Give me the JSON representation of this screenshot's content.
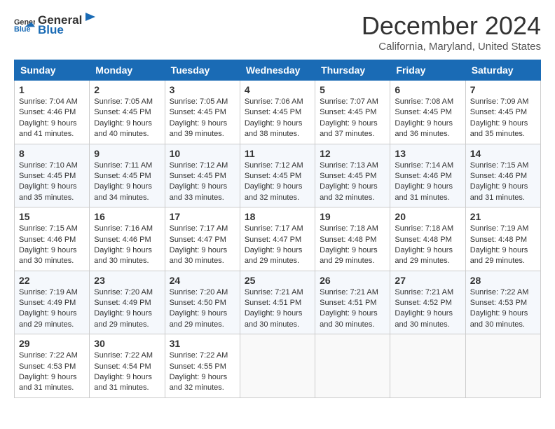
{
  "logo": {
    "general": "General",
    "blue": "Blue"
  },
  "title": "December 2024",
  "subtitle": "California, Maryland, United States",
  "days": [
    "Sunday",
    "Monday",
    "Tuesday",
    "Wednesday",
    "Thursday",
    "Friday",
    "Saturday"
  ],
  "weeks": [
    [
      {
        "day": 1,
        "lines": [
          "Sunrise: 7:04 AM",
          "Sunset: 4:46 PM",
          "Daylight: 9 hours",
          "and 41 minutes."
        ]
      },
      {
        "day": 2,
        "lines": [
          "Sunrise: 7:05 AM",
          "Sunset: 4:45 PM",
          "Daylight: 9 hours",
          "and 40 minutes."
        ]
      },
      {
        "day": 3,
        "lines": [
          "Sunrise: 7:05 AM",
          "Sunset: 4:45 PM",
          "Daylight: 9 hours",
          "and 39 minutes."
        ]
      },
      {
        "day": 4,
        "lines": [
          "Sunrise: 7:06 AM",
          "Sunset: 4:45 PM",
          "Daylight: 9 hours",
          "and 38 minutes."
        ]
      },
      {
        "day": 5,
        "lines": [
          "Sunrise: 7:07 AM",
          "Sunset: 4:45 PM",
          "Daylight: 9 hours",
          "and 37 minutes."
        ]
      },
      {
        "day": 6,
        "lines": [
          "Sunrise: 7:08 AM",
          "Sunset: 4:45 PM",
          "Daylight: 9 hours",
          "and 36 minutes."
        ]
      },
      {
        "day": 7,
        "lines": [
          "Sunrise: 7:09 AM",
          "Sunset: 4:45 PM",
          "Daylight: 9 hours",
          "and 35 minutes."
        ]
      }
    ],
    [
      {
        "day": 8,
        "lines": [
          "Sunrise: 7:10 AM",
          "Sunset: 4:45 PM",
          "Daylight: 9 hours",
          "and 35 minutes."
        ]
      },
      {
        "day": 9,
        "lines": [
          "Sunrise: 7:11 AM",
          "Sunset: 4:45 PM",
          "Daylight: 9 hours",
          "and 34 minutes."
        ]
      },
      {
        "day": 10,
        "lines": [
          "Sunrise: 7:12 AM",
          "Sunset: 4:45 PM",
          "Daylight: 9 hours",
          "and 33 minutes."
        ]
      },
      {
        "day": 11,
        "lines": [
          "Sunrise: 7:12 AM",
          "Sunset: 4:45 PM",
          "Daylight: 9 hours",
          "and 32 minutes."
        ]
      },
      {
        "day": 12,
        "lines": [
          "Sunrise: 7:13 AM",
          "Sunset: 4:45 PM",
          "Daylight: 9 hours",
          "and 32 minutes."
        ]
      },
      {
        "day": 13,
        "lines": [
          "Sunrise: 7:14 AM",
          "Sunset: 4:46 PM",
          "Daylight: 9 hours",
          "and 31 minutes."
        ]
      },
      {
        "day": 14,
        "lines": [
          "Sunrise: 7:15 AM",
          "Sunset: 4:46 PM",
          "Daylight: 9 hours",
          "and 31 minutes."
        ]
      }
    ],
    [
      {
        "day": 15,
        "lines": [
          "Sunrise: 7:15 AM",
          "Sunset: 4:46 PM",
          "Daylight: 9 hours",
          "and 30 minutes."
        ]
      },
      {
        "day": 16,
        "lines": [
          "Sunrise: 7:16 AM",
          "Sunset: 4:46 PM",
          "Daylight: 9 hours",
          "and 30 minutes."
        ]
      },
      {
        "day": 17,
        "lines": [
          "Sunrise: 7:17 AM",
          "Sunset: 4:47 PM",
          "Daylight: 9 hours",
          "and 30 minutes."
        ]
      },
      {
        "day": 18,
        "lines": [
          "Sunrise: 7:17 AM",
          "Sunset: 4:47 PM",
          "Daylight: 9 hours",
          "and 29 minutes."
        ]
      },
      {
        "day": 19,
        "lines": [
          "Sunrise: 7:18 AM",
          "Sunset: 4:48 PM",
          "Daylight: 9 hours",
          "and 29 minutes."
        ]
      },
      {
        "day": 20,
        "lines": [
          "Sunrise: 7:18 AM",
          "Sunset: 4:48 PM",
          "Daylight: 9 hours",
          "and 29 minutes."
        ]
      },
      {
        "day": 21,
        "lines": [
          "Sunrise: 7:19 AM",
          "Sunset: 4:48 PM",
          "Daylight: 9 hours",
          "and 29 minutes."
        ]
      }
    ],
    [
      {
        "day": 22,
        "lines": [
          "Sunrise: 7:19 AM",
          "Sunset: 4:49 PM",
          "Daylight: 9 hours",
          "and 29 minutes."
        ]
      },
      {
        "day": 23,
        "lines": [
          "Sunrise: 7:20 AM",
          "Sunset: 4:49 PM",
          "Daylight: 9 hours",
          "and 29 minutes."
        ]
      },
      {
        "day": 24,
        "lines": [
          "Sunrise: 7:20 AM",
          "Sunset: 4:50 PM",
          "Daylight: 9 hours",
          "and 29 minutes."
        ]
      },
      {
        "day": 25,
        "lines": [
          "Sunrise: 7:21 AM",
          "Sunset: 4:51 PM",
          "Daylight: 9 hours",
          "and 30 minutes."
        ]
      },
      {
        "day": 26,
        "lines": [
          "Sunrise: 7:21 AM",
          "Sunset: 4:51 PM",
          "Daylight: 9 hours",
          "and 30 minutes."
        ]
      },
      {
        "day": 27,
        "lines": [
          "Sunrise: 7:21 AM",
          "Sunset: 4:52 PM",
          "Daylight: 9 hours",
          "and 30 minutes."
        ]
      },
      {
        "day": 28,
        "lines": [
          "Sunrise: 7:22 AM",
          "Sunset: 4:53 PM",
          "Daylight: 9 hours",
          "and 30 minutes."
        ]
      }
    ],
    [
      {
        "day": 29,
        "lines": [
          "Sunrise: 7:22 AM",
          "Sunset: 4:53 PM",
          "Daylight: 9 hours",
          "and 31 minutes."
        ]
      },
      {
        "day": 30,
        "lines": [
          "Sunrise: 7:22 AM",
          "Sunset: 4:54 PM",
          "Daylight: 9 hours",
          "and 31 minutes."
        ]
      },
      {
        "day": 31,
        "lines": [
          "Sunrise: 7:22 AM",
          "Sunset: 4:55 PM",
          "Daylight: 9 hours",
          "and 32 minutes."
        ]
      },
      null,
      null,
      null,
      null
    ]
  ]
}
